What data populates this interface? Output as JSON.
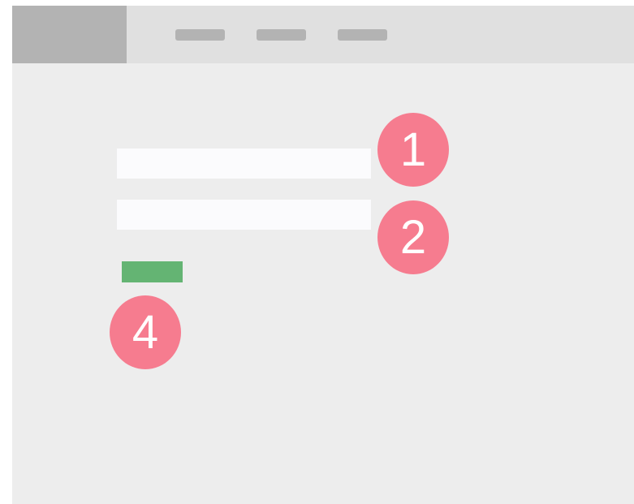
{
  "markers": {
    "m1": "1",
    "m2": "2",
    "m4": "4"
  },
  "colors": {
    "background": "#ededed",
    "topbar": "#e0e0e0",
    "placeholder_gray": "#b3b3b3",
    "input_fill": "#fbfbfd",
    "button": "#64b473",
    "marker": "#f67c8f"
  }
}
